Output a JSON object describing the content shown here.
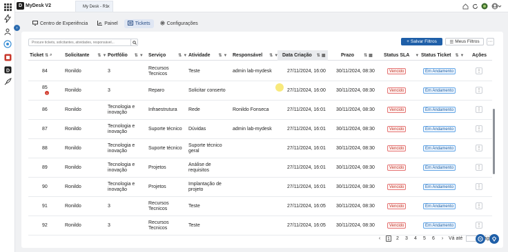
{
  "app": {
    "title": "MyDesk V2",
    "logo_letter": "D"
  },
  "window_tab": {
    "label": "My Desk - R1",
    "close": "×"
  },
  "nav_tabs": [
    {
      "label": "Centro de Experiência",
      "icon": "desktop-icon"
    },
    {
      "label": "Painel",
      "icon": "chart-icon"
    },
    {
      "label": "Tickets",
      "icon": "ticket-icon",
      "active": true
    },
    {
      "label": "Configurações",
      "icon": "gear-icon"
    }
  ],
  "toolbar": {
    "search_placeholder": "Procure tickets, solicitantes, atividades, responsável...",
    "save_filters": "Salvar Filtros",
    "my_filters": "Meus Filtros",
    "more": "···"
  },
  "columns": [
    "Ticket",
    "Solicitante",
    "Portfólio",
    "Serviço",
    "Atividade",
    "Responsável",
    "Data Criação",
    "Prazo",
    "Status SLA",
    "Status Ticket",
    "Ações"
  ],
  "rows": [
    {
      "ticket": "84",
      "solicitante": "Ronildo",
      "portfolio": "3",
      "servico": "Recursos Tecnicos",
      "atividade": "Teste",
      "responsavel": "admin lab-mydesk",
      "criacao": "27/11/2024, 16:00",
      "prazo": "30/11/2024, 08:30",
      "sla": "Vencido",
      "status": "Em Andamento"
    },
    {
      "ticket": "85",
      "solicitante": "Ronildo",
      "portfolio": "3",
      "servico": "Reparo",
      "atividade": "Solicitar conserto",
      "responsavel": "",
      "criacao": "27/11/2024, 16:00",
      "prazo": "30/11/2024, 08:30",
      "sla": "Vencido",
      "status": "Em Andamento",
      "notif": "1"
    },
    {
      "ticket": "86",
      "solicitante": "Ronildo",
      "portfolio": "Tecnologia e inovação",
      "servico": "Infraestrutura",
      "atividade": "Rede",
      "responsavel": "Ronildo Fonseca",
      "criacao": "27/11/2024, 16:01",
      "prazo": "30/11/2024, 08:30",
      "sla": "Vencido",
      "status": "Em Andamento"
    },
    {
      "ticket": "87",
      "solicitante": "Ronildo",
      "portfolio": "Tecnologia e inovação",
      "servico": "Suporte técnico",
      "atividade": "Dúvidas",
      "responsavel": "admin lab-mydesk",
      "criacao": "27/11/2024, 16:01",
      "prazo": "30/11/2024, 08:30",
      "sla": "Vencido",
      "status": "Em Andamento"
    },
    {
      "ticket": "88",
      "solicitante": "Ronildo",
      "portfolio": "Tecnologia e inovação",
      "servico": "Suporte técnico",
      "atividade": "Suporte técnico geral",
      "responsavel": "",
      "criacao": "27/11/2024, 16:01",
      "prazo": "30/11/2024, 08:30",
      "sla": "Vencido",
      "status": "Em Andamento"
    },
    {
      "ticket": "89",
      "solicitante": "Ronildo",
      "portfolio": "Tecnologia e inovação",
      "servico": "Projetos",
      "atividade": "Análise de requisitos",
      "responsavel": "",
      "criacao": "27/11/2024, 16:01",
      "prazo": "30/11/2024, 08:30",
      "sla": "Vencido",
      "status": "Em Andamento"
    },
    {
      "ticket": "90",
      "solicitante": "Ronildo",
      "portfolio": "Tecnologia e inovação",
      "servico": "Projetos",
      "atividade": "Implantação de projeto",
      "responsavel": "",
      "criacao": "27/11/2024, 16:01",
      "prazo": "30/11/2024, 08:30",
      "sla": "Vencido",
      "status": "Em Andamento"
    },
    {
      "ticket": "91",
      "solicitante": "Ronildo",
      "portfolio": "3",
      "servico": "Recursos Tecnicos",
      "atividade": "Teste",
      "responsavel": "",
      "criacao": "27/11/2024, 16:05",
      "prazo": "30/11/2024, 08:30",
      "sla": "Vencido",
      "status": "Em Andamento"
    },
    {
      "ticket": "92",
      "solicitante": "Ronildo",
      "portfolio": "3",
      "servico": "Recursos Tecnicos",
      "atividade": "Teste",
      "responsavel": "",
      "criacao": "27/11/2024, 16:05",
      "prazo": "30/11/2024, 08:30",
      "sla": "Vencido",
      "status": "Em Andamento"
    }
  ],
  "pagination": {
    "pages": [
      "1",
      "2",
      "3",
      "4",
      "5",
      "6"
    ],
    "current": "1",
    "prev": "‹",
    "next": "›",
    "goto_label": "Vá até",
    "page_label": "Página"
  },
  "colors": {
    "primary": "#1f5fa8",
    "sla_red": "#c0392b",
    "status_blue": "#1d5fa3"
  }
}
